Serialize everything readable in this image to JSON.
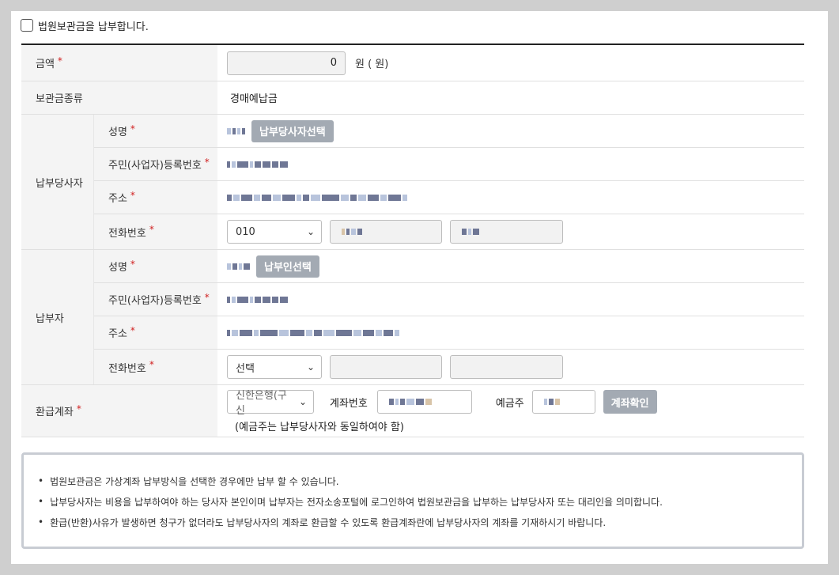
{
  "agree": {
    "label": "법원보관금을 납부합니다."
  },
  "amount": {
    "label": "금액",
    "value": "0",
    "unit": "원 ( 원)"
  },
  "deposit_type": {
    "label": "보관금종류",
    "value": "경매예납금"
  },
  "payer_party": {
    "label": "납부당사자",
    "name_label": "성명",
    "select_button": "납부당사자선택",
    "id_label": "주민(사업자)등록번호",
    "address_label": "주소",
    "phone_label": "전화번호",
    "phone_prefix": "010"
  },
  "payer": {
    "label": "납부자",
    "name_label": "성명",
    "select_button": "납부인선택",
    "id_label": "주민(사업자)등록번호",
    "address_label": "주소",
    "phone_label": "전화번호",
    "phone_prefix": "선택"
  },
  "refund": {
    "label": "환급계좌",
    "bank": "신한은행(구 신",
    "account_label": "계좌번호",
    "holder_label": "예금주",
    "check_button": "계좌확인",
    "note": "(예금주는 납부당사자와 동일하여야 함)"
  },
  "notices": [
    "법원보관금은 가상계좌 납부방식을 선택한 경우에만 납부 할 수 있습니다.",
    "납부당사자는 비용을 납부하여야 하는 당사자 본인이며 납부자는 전자소송포털에 로그인하여 법원보관금을 납부하는 납부당사자 또는 대리인을 의미합니다.",
    "환급(반환)사유가 발생하면 청구가 없더라도 납부당사자의 계좌로 환급할 수 있도록 환급계좌란에 납부당사자의 계좌를 기재하시기 바랍니다."
  ],
  "colors": {
    "required": "#d02020",
    "button": "#a3aab3",
    "label_bg": "#f4f4f4"
  }
}
